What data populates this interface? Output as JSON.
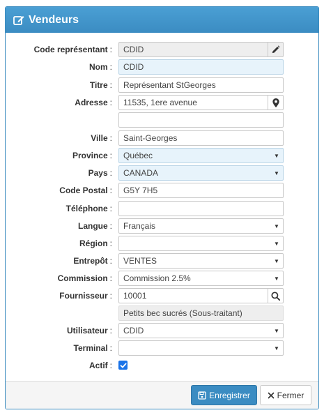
{
  "header": {
    "title": "Vendeurs"
  },
  "colon": ":",
  "fields": {
    "code": {
      "label": "Code représentant",
      "value": "CDID"
    },
    "nom": {
      "label": "Nom",
      "value": "CDID"
    },
    "titre": {
      "label": "Titre",
      "value": "Représentant StGeorges"
    },
    "adresse": {
      "label": "Adresse",
      "value": "11535, 1ere avenue",
      "value2": ""
    },
    "ville": {
      "label": "Ville",
      "value": "Saint-Georges"
    },
    "province": {
      "label": "Province",
      "value": "Québec"
    },
    "pays": {
      "label": "Pays",
      "value": "CANADA"
    },
    "code_postal": {
      "label": "Code Postal",
      "value": "G5Y 7H5"
    },
    "telephone": {
      "label": "Téléphone",
      "value": ""
    },
    "langue": {
      "label": "Langue",
      "value": "Français"
    },
    "region": {
      "label": "Région",
      "value": ""
    },
    "entrepot": {
      "label": "Entrepôt",
      "value": "VENTES"
    },
    "commission": {
      "label": "Commission",
      "value": "Commission 2.5%"
    },
    "fournisseur": {
      "label": "Fournisseur",
      "value": "10001",
      "description": "Petits bec sucrés (Sous-traitant)"
    },
    "utilisateur": {
      "label": "Utilisateur",
      "value": "CDID"
    },
    "terminal": {
      "label": "Terminal",
      "value": ""
    },
    "actif": {
      "label": "Actif",
      "checked": true
    }
  },
  "footer": {
    "save_label": "Enregistrer",
    "close_label": "Fermer"
  },
  "colors": {
    "primary": "#3b8cc2",
    "checkbox": "#1a73e8"
  }
}
